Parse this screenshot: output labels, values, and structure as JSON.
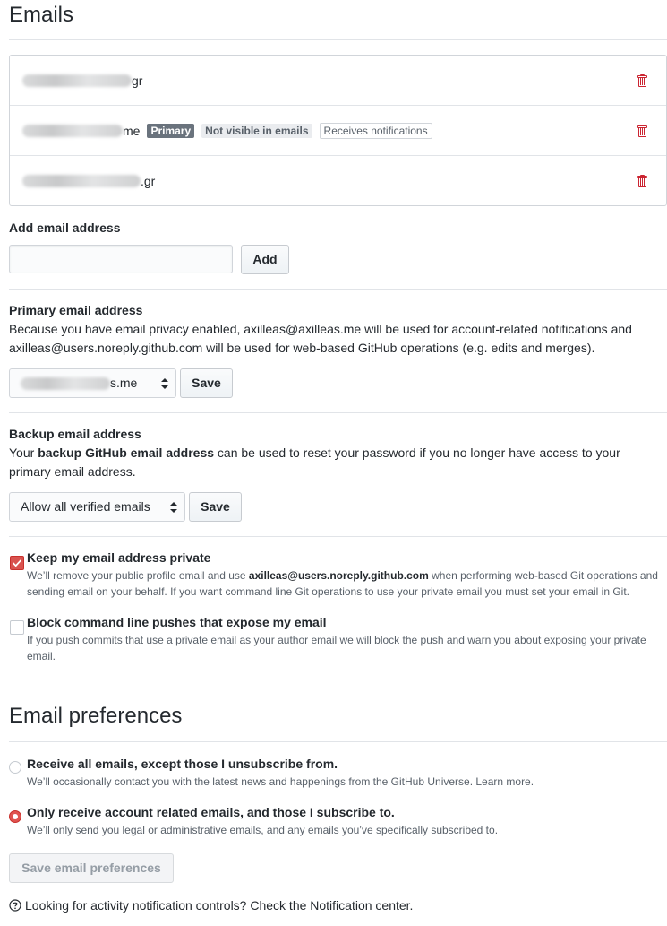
{
  "emails_section": {
    "title": "Emails",
    "rows": [
      {
        "suffix": "gr",
        "badges": []
      },
      {
        "suffix": "me",
        "badges": [
          "Primary",
          "Not visible in emails",
          "Receives notifications"
        ]
      },
      {
        "suffix": ".gr",
        "badges": []
      }
    ],
    "delete_icon": "trash-icon"
  },
  "add_email": {
    "label": "Add email address",
    "input_value": "",
    "button": "Add"
  },
  "primary_email": {
    "label": "Primary email address",
    "description": "Because you have email privacy enabled, axilleas@axilleas.me will be used for account-related notifications and axilleas@users.noreply.github.com will be used for web-based GitHub operations (e.g. edits and merges).",
    "select_value_suffix": "s.me",
    "button": "Save"
  },
  "backup_email": {
    "label": "Backup email address",
    "desc_prefix": "Your ",
    "desc_strong": "backup GitHub email address",
    "desc_suffix": " can be used to reset your password if you no longer have access to your primary email address.",
    "select_value": "Allow all verified emails",
    "button": "Save"
  },
  "privacy": {
    "keep_private": {
      "label": "Keep my email address private",
      "checked": true,
      "note_prefix": "We’ll remove your public profile email and use ",
      "note_email": "axilleas@users.noreply.github.com",
      "note_suffix": " when performing web-based Git operations and sending email on your behalf. If you want command line Git operations to use your private email you must set your email in Git."
    },
    "block_pushes": {
      "label": "Block command line pushes that expose my email",
      "checked": false,
      "note": "If you push commits that use a private email as your author email we will block the push and warn you about exposing your private email."
    }
  },
  "preferences": {
    "title": "Email preferences",
    "options": [
      {
        "label": "Receive all emails, except those I unsubscribe from.",
        "note": "We’ll occasionally contact you with the latest news and happenings from the GitHub Universe. Learn more.",
        "selected": false
      },
      {
        "label": "Only receive account related emails, and those I subscribe to.",
        "note": "We’ll only send you legal or administrative emails, and any emails you’ve specifically subscribed to.",
        "selected": true
      }
    ],
    "save_button": "Save email preferences",
    "footer": "Looking for activity notification controls? Check the Notification center."
  },
  "colors": {
    "accent": "#d9534f",
    "trash": "#cb2431"
  }
}
